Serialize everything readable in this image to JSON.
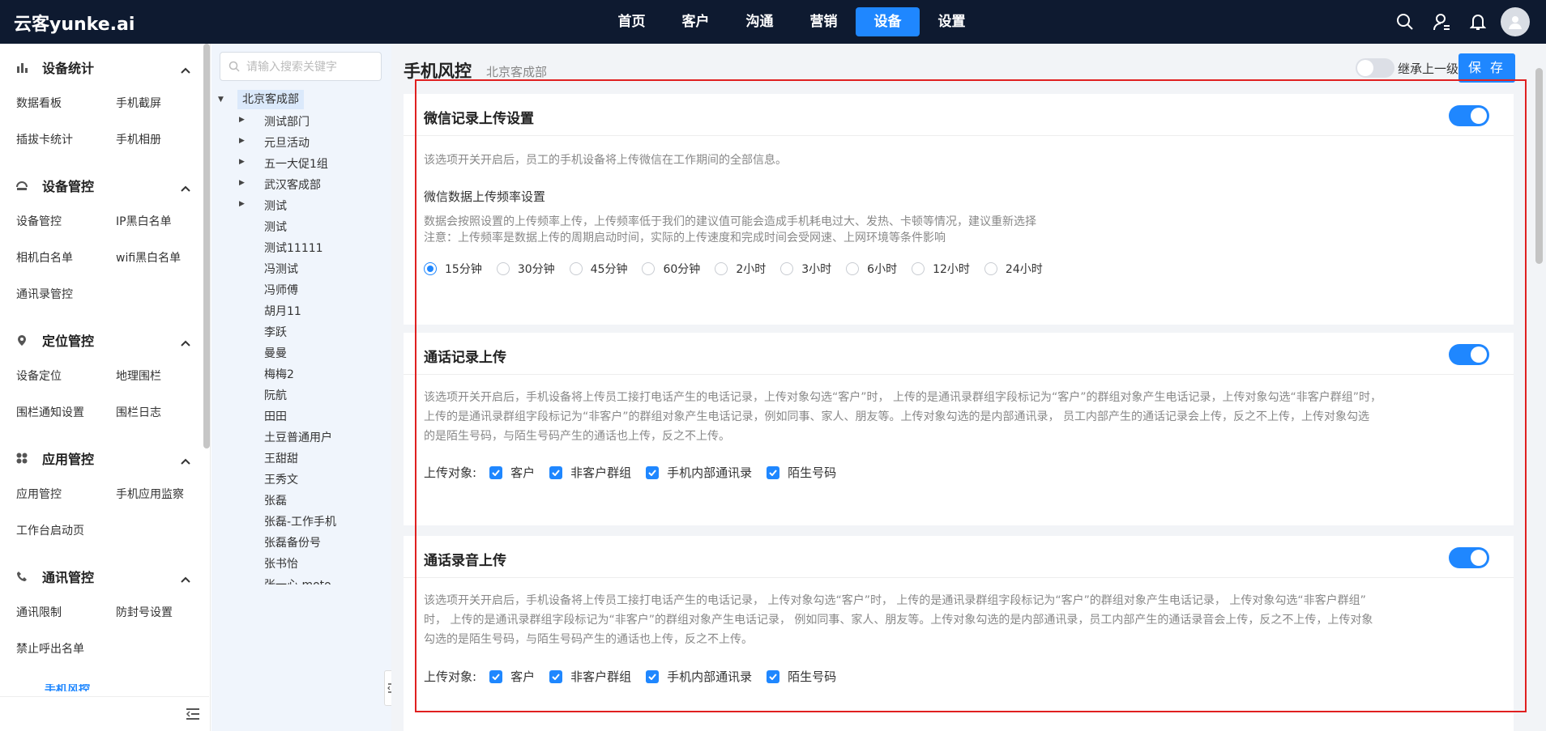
{
  "app": {
    "logo": "云客yunke.ai"
  },
  "nav": {
    "items": [
      {
        "label": "首页",
        "active": false
      },
      {
        "label": "客户",
        "active": false
      },
      {
        "label": "沟通",
        "active": false
      },
      {
        "label": "营销",
        "active": false
      },
      {
        "label": "设备",
        "active": true
      },
      {
        "label": "设置",
        "active": false
      }
    ]
  },
  "colors": {
    "accent": "#1f87ff",
    "topbar": "#0e1a30",
    "highlight": "#e02020"
  },
  "sidebar": {
    "groups": [
      {
        "title": "设备统计",
        "icon": "bar-chart-icon",
        "links": [
          "数据看板",
          "手机截屏",
          "插拔卡统计",
          "手机相册"
        ]
      },
      {
        "title": "设备管控",
        "icon": "device-icon",
        "links": [
          "设备管控",
          "IP黑白名单",
          "相机白名单",
          "wifi黑白名单",
          "通讯录管控"
        ]
      },
      {
        "title": "定位管控",
        "icon": "location-pin-icon",
        "links": [
          "设备定位",
          "地理围栏",
          "围栏通知设置",
          "围栏日志"
        ]
      },
      {
        "title": "应用管控",
        "icon": "apps-grid-icon",
        "links": [
          "应用管控",
          "手机应用监察",
          "工作台启动页"
        ]
      },
      {
        "title": "通讯管控",
        "icon": "phone-icon",
        "links": [
          "通讯限制",
          "防封号设置",
          "禁止呼出名单"
        ]
      }
    ],
    "partial_next": "手机风控"
  },
  "tree": {
    "search_placeholder": "请输入搜索关键字",
    "root": "北京客成部",
    "children": [
      {
        "label": "测试部门",
        "expandable": true
      },
      {
        "label": "元旦活动",
        "expandable": true
      },
      {
        "label": "五一大促1组",
        "expandable": true
      },
      {
        "label": "武汉客成部",
        "expandable": true
      },
      {
        "label": "测试",
        "expandable": true
      },
      {
        "label": "测试",
        "expandable": false
      },
      {
        "label": "测试11111",
        "expandable": false
      },
      {
        "label": "冯测试",
        "expandable": false
      },
      {
        "label": "冯师傅",
        "expandable": false
      },
      {
        "label": "胡月11",
        "expandable": false
      },
      {
        "label": "李跃",
        "expandable": false
      },
      {
        "label": "曼曼",
        "expandable": false
      },
      {
        "label": "梅梅2",
        "expandable": false
      },
      {
        "label": "阮航",
        "expandable": false
      },
      {
        "label": "田田",
        "expandable": false
      },
      {
        "label": "土豆普通用户",
        "expandable": false
      },
      {
        "label": "王甜甜",
        "expandable": false
      },
      {
        "label": "王秀文",
        "expandable": false
      },
      {
        "label": "张磊",
        "expandable": false
      },
      {
        "label": "张磊-工作手机",
        "expandable": false
      },
      {
        "label": "张磊备份号",
        "expandable": false
      },
      {
        "label": "张书怡",
        "expandable": false
      },
      {
        "label": "张一心 moto",
        "expandable": false
      }
    ]
  },
  "page": {
    "title": "手机风控",
    "subtitle": "北京客成部",
    "inherit_label": "继承上一级",
    "inherit_on": false,
    "save_label": "保 存"
  },
  "cards": [
    {
      "title": "微信记录上传设置",
      "enabled": true,
      "desc": "该选项开关开启后，员工的手机设备将上传微信在工作期间的全部信息。",
      "sub_title": "微信数据上传频率设置",
      "note1": "数据会按照设置的上传频率上传，上传频率低于我们的建议值可能会造成手机耗电过大、发热、卡顿等情况，建议重新选择",
      "note2": "注意：上传频率是数据上传的周期启动时间，实际的上传速度和完成时间会受网速、上网环境等条件影响",
      "options": [
        "15分钟",
        "30分钟",
        "45分钟",
        "60分钟",
        "2小时",
        "3小时",
        "6小时",
        "12小时",
        "24小时"
      ],
      "selected": "15分钟"
    },
    {
      "title": "通话记录上传",
      "enabled": true,
      "desc1": "该选项开关开启后，手机设备将上传员工接打电话产生的电话记录，上传对象勾选“客户”时， 上传的是通讯录群组字段标记为“客户”的群组对象产生电话记录，上传对象勾选“非客户群组”时，",
      "desc2": "上传的是通讯录群组字段标记为“非客户”的群组对象产生电话记录，例如同事、家人、朋友等。上传对象勾选的是内部通讯录， 员工内部产生的通话记录会上传，反之不上传，上传对象勾选",
      "desc3": "的是陌生号码，与陌生号码产生的通话也上传，反之不上传。",
      "upload_label": "上传对象:",
      "targets": [
        "客户",
        "非客户群组",
        "手机内部通讯录",
        "陌生号码"
      ]
    },
    {
      "title": "通话录音上传",
      "enabled": true,
      "desc1": "该选项开关开启后，手机设备将上传员工接打电话产生的电话记录， 上传对象勾选“客户”时， 上传的是通讯录群组字段标记为“客户”的群组对象产生电话记录， 上传对象勾选“非客户群组”",
      "desc2": "时， 上传的是通讯录群组字段标记为“非客户”的群组对象产生电话记录， 例如同事、家人、朋友等。上传对象勾选的是内部通讯录，员工内部产生的通话录音会上传，反之不上传，上传对象",
      "desc3": "勾选的是陌生号码，与陌生号码产生的通话也上传，反之不上传。",
      "upload_label": "上传对象:",
      "targets": [
        "客户",
        "非客户群组",
        "手机内部通讯录",
        "陌生号码"
      ]
    }
  ]
}
